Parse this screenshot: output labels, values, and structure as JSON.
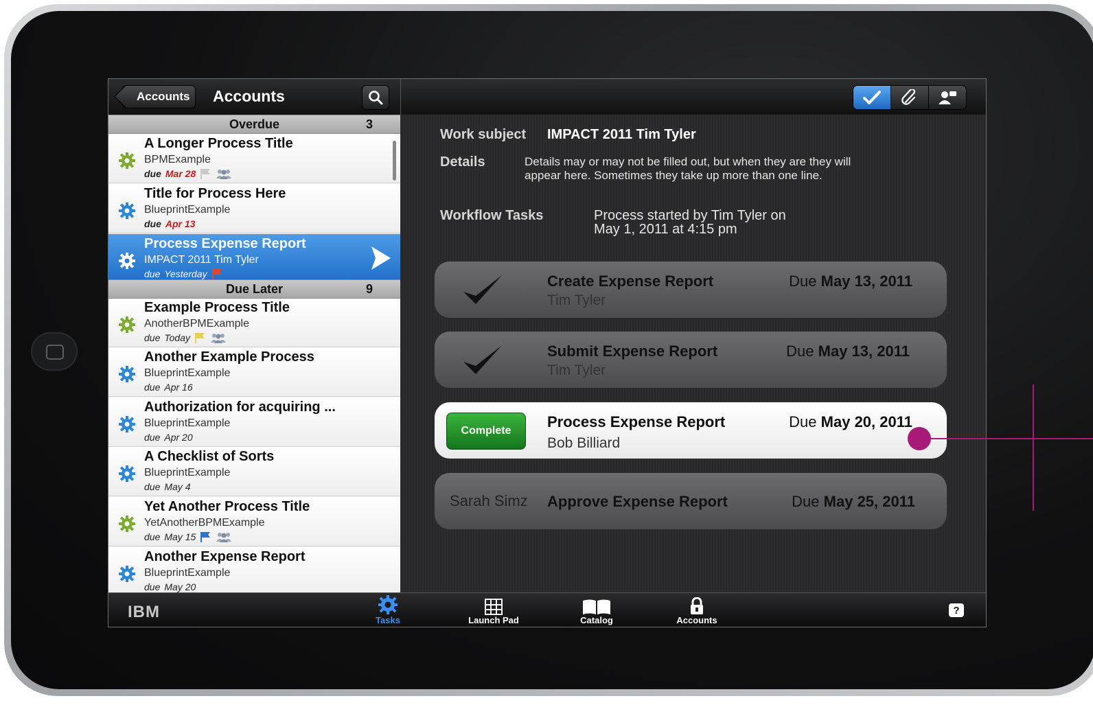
{
  "nav": {
    "back_label": "Accounts",
    "title": "Accounts"
  },
  "sections": {
    "overdue": {
      "label": "Overdue",
      "count": "3"
    },
    "due_later": {
      "label": "Due Later",
      "count": "9"
    }
  },
  "tasks": [
    {
      "title": "A Longer Process Title",
      "app": "BPMExample",
      "due_label": "due",
      "due": "Mar 28",
      "due_red": true,
      "flag": "gray",
      "people": true,
      "gear": "green"
    },
    {
      "title": "Title for Process Here",
      "app": "BlueprintExample",
      "due_label": "due",
      "due": "Apr 13",
      "due_red": true,
      "flag": "",
      "people": false,
      "gear": "blue"
    },
    {
      "title": "Process Expense Report",
      "app": "IMPACT 2011 Tim Tyler",
      "due_label": "due",
      "due": "Yesterday",
      "due_red": false,
      "flag": "red",
      "people": false,
      "gear": "white",
      "selected": true
    },
    {
      "title": "Example Process Title",
      "app": "AnotherBPMExample",
      "due_label": "due",
      "due": "Today",
      "due_red": false,
      "flag": "yellow",
      "people": true,
      "gear": "green"
    },
    {
      "title": "Another Example Process",
      "app": "BlueprintExample",
      "due_label": "due",
      "due": "Apr 16",
      "due_red": false,
      "flag": "",
      "people": false,
      "gear": "blue"
    },
    {
      "title": "Authorization for acquiring ...",
      "app": "BlueprintExample",
      "due_label": "due",
      "due": "Apr 20",
      "due_red": false,
      "flag": "",
      "people": false,
      "gear": "blue"
    },
    {
      "title": "A Checklist of Sorts",
      "app": "BlueprintExample",
      "due_label": "due",
      "due": "May 4",
      "due_red": false,
      "flag": "",
      "people": false,
      "gear": "blue"
    },
    {
      "title": "Yet Another Process Title",
      "app": "YetAnotherBPMExample",
      "due_label": "due",
      "due": "May 15",
      "due_red": false,
      "flag": "blue",
      "people": true,
      "gear": "green"
    },
    {
      "title": "Another Expense Report",
      "app": "BlueprintExample",
      "due_label": "due",
      "due": "May 20",
      "due_red": false,
      "flag": "",
      "people": false,
      "gear": "blue"
    }
  ],
  "detail": {
    "work_subject_label": "Work subject",
    "work_subject": "IMPACT 2011 Tim Tyler",
    "details_label": "Details",
    "details_line1": "Details may or may not be filled out, but when they are they will",
    "details_line2": "appear here. Sometimes they take up more than one line.",
    "workflow_label": "Workflow Tasks",
    "workflow_line1": "Process started by Tim Tyler on",
    "workflow_line2": "May 1, 2011 at 4:15 pm"
  },
  "workflow_tasks": [
    {
      "name": "Create Expense Report",
      "person": "Tim Tyler",
      "due_prefix": "Due",
      "due": "May 13, 2011",
      "state": "done"
    },
    {
      "name": "Submit Expense Report",
      "person": "Tim Tyler",
      "due_prefix": "Due",
      "due": "May 13, 2011",
      "state": "done"
    },
    {
      "name": "Process Expense Report",
      "person": "Bob Billiard",
      "due_prefix": "Due",
      "due": "May 20, 2011",
      "state": "active",
      "button": "Complete"
    },
    {
      "name": "Approve Expense Report",
      "person": "Sarah Simz",
      "due_prefix": "Due",
      "due": "May 25, 2011",
      "state": "pending"
    }
  ],
  "toolbar_icons": [
    "checkmark-icon",
    "paperclip-icon",
    "person-add-icon"
  ],
  "tabs": [
    {
      "label": "Tasks",
      "icon": "gear-icon",
      "active": true
    },
    {
      "label": "Launch Pad",
      "icon": "grid-icon",
      "active": false
    },
    {
      "label": "Catalog",
      "icon": "book-icon",
      "active": false
    },
    {
      "label": "Accounts",
      "icon": "lock-icon",
      "active": false
    }
  ],
  "footer": {
    "logo": "IBM",
    "help": "?"
  },
  "colors": {
    "selected": "#1e6fcb",
    "overdue_red": "#c8191e",
    "complete_green": "#15761d",
    "annotation": "#a71a78"
  }
}
